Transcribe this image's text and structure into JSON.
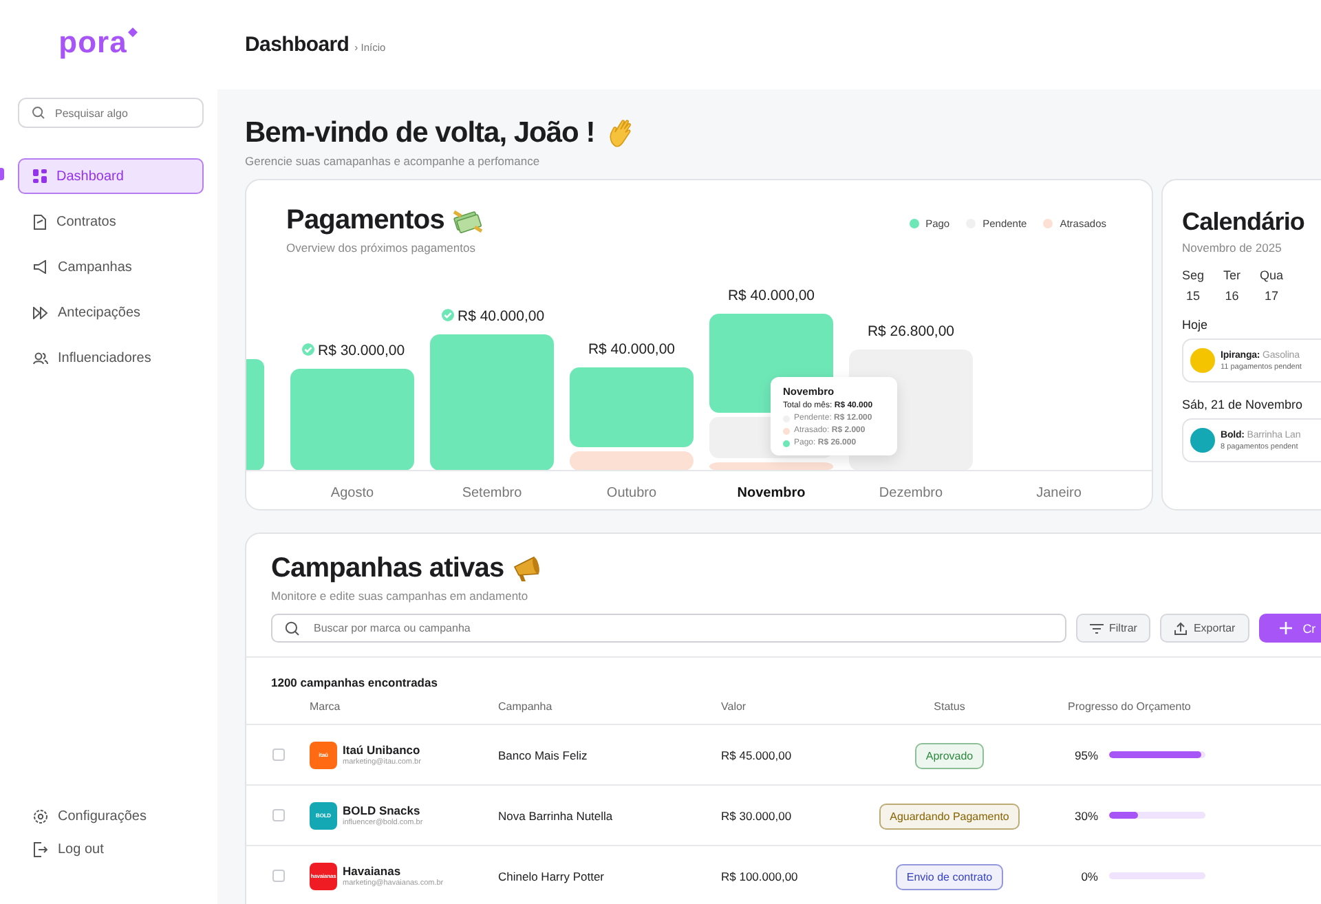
{
  "sidebar": {
    "logo": "pora",
    "search": {
      "placeholder": "Pesquisar algo"
    },
    "nav": [
      {
        "label": "Dashboard",
        "selected": true
      },
      {
        "label": "Contratos",
        "selected": false
      },
      {
        "label": "Campanhas",
        "selected": false
      },
      {
        "label": "Antecipações",
        "selected": false
      },
      {
        "label": "Influenciadores",
        "selected": false
      }
    ],
    "footer": [
      {
        "label": "Configurações"
      },
      {
        "label": "Log out"
      }
    ]
  },
  "header": {
    "title": "Dashboard",
    "breadcrumb": "› Início"
  },
  "welcome": {
    "title": "Bem-vindo de volta, João !",
    "subtitle": "Gerencie suas camapanhas e acompanhe a perfomance"
  },
  "payments": {
    "title": "Pagamentos",
    "subtitle": "Overview dos próximos pagamentos",
    "legend": [
      {
        "label": "Pago",
        "color": "#6ee7b7"
      },
      {
        "label": "Pendente",
        "color": "#f0f0f0"
      },
      {
        "label": "Atrasados",
        "color": "#fde0d4"
      }
    ],
    "months": [
      {
        "label": "Agosto",
        "selected": false,
        "total": "R$ 30.000,00",
        "checked": true
      },
      {
        "label": "Setembro",
        "selected": false,
        "total": "R$ 40.000,00",
        "checked": true
      },
      {
        "label": "Outubro",
        "selected": false,
        "total": "R$ 40.000,00",
        "checked": false
      },
      {
        "label": "Novembro",
        "selected": true,
        "total": "R$ 40.000,00",
        "checked": false
      },
      {
        "label": "Dezembro",
        "selected": false,
        "total": "R$ 26.800,00",
        "checked": false
      },
      {
        "label": "Janeiro",
        "selected": false
      }
    ],
    "tooltip": {
      "title": "Novembro",
      "total": "Total do mês: **R$ 40.000**",
      "lines": [
        {
          "text": "Pendente: **R$ 12.000**",
          "color": "#f0f0f0"
        },
        {
          "text": "Atrasado: **R$ 2.000**",
          "color": "#fde0d4"
        },
        {
          "text": "Pago: **R$ 26.000**",
          "color": "#6ee7b7"
        }
      ]
    }
  },
  "calendar": {
    "title": "Calendário",
    "subtitle": "Novembro de 2025",
    "days": [
      {
        "weekday": "Seg",
        "date": "15"
      },
      {
        "weekday": "Ter",
        "date": "16"
      },
      {
        "weekday": "Qua",
        "date": "17"
      }
    ],
    "groups": [
      {
        "heading": "Hoje",
        "events": [
          {
            "brand": "Ipiranga:",
            "title": "Gasolina",
            "info": "11 pagamentos pendent",
            "color": "#f5c400"
          }
        ]
      },
      {
        "heading": "Sáb, 21 de Novembro",
        "events": [
          {
            "brand": "Bold:",
            "title": "Barrinha Lan",
            "info": "8 pagamentos pendent",
            "color": "#14a8b4"
          }
        ]
      }
    ]
  },
  "campaigns": {
    "title": "Campanhas ativas",
    "subtitle": "Monitore e edite suas campanhas em andamento",
    "search": {
      "placeholder": "Buscar por marca ou campanha"
    },
    "actions": [
      {
        "label": "Filtrar",
        "kind": "filter"
      },
      {
        "label": "Exportar",
        "kind": "export"
      },
      {
        "label": "Cr",
        "kind": "create"
      }
    ],
    "count": "1200 campanhas encontradas",
    "columns": [
      "Marca",
      "Campanha",
      "Valor",
      "Status",
      "Progresso do Orçamento"
    ],
    "rows": [
      {
        "checked": false,
        "logo": "itaú",
        "color": "#ff6a13",
        "brand": "Itaú Unibanco",
        "email": "marketing@itau.com.br",
        "campaign": "Banco Mais Feliz",
        "value": "R$ 45.000,00",
        "status": {
          "label": "Aprovado",
          "color": "#2c8a3c"
        },
        "progress": "95%",
        "level": 0.95
      },
      {
        "checked": false,
        "logo": "BOLD",
        "color": "#14a8b4",
        "brand": "BOLD Snacks",
        "email": "influencer@bold.com.br",
        "campaign": "Nova Barrinha Nutella",
        "value": "R$ 30.000,00",
        "status": {
          "label": "Aguardando Pagamento",
          "color": "#866400"
        },
        "progress": "30%",
        "level": 0.3
      },
      {
        "checked": false,
        "logo": "havaianas",
        "color": "#f01c24",
        "brand": "Havaianas",
        "email": "marketing@havaianas.com.br",
        "campaign": "Chinelo Harry Potter",
        "value": "R$ 100.000,00",
        "status": {
          "label": "Envio de contrato",
          "color": "#3540c4"
        },
        "progress": "0%",
        "level": 0
      }
    ]
  }
}
